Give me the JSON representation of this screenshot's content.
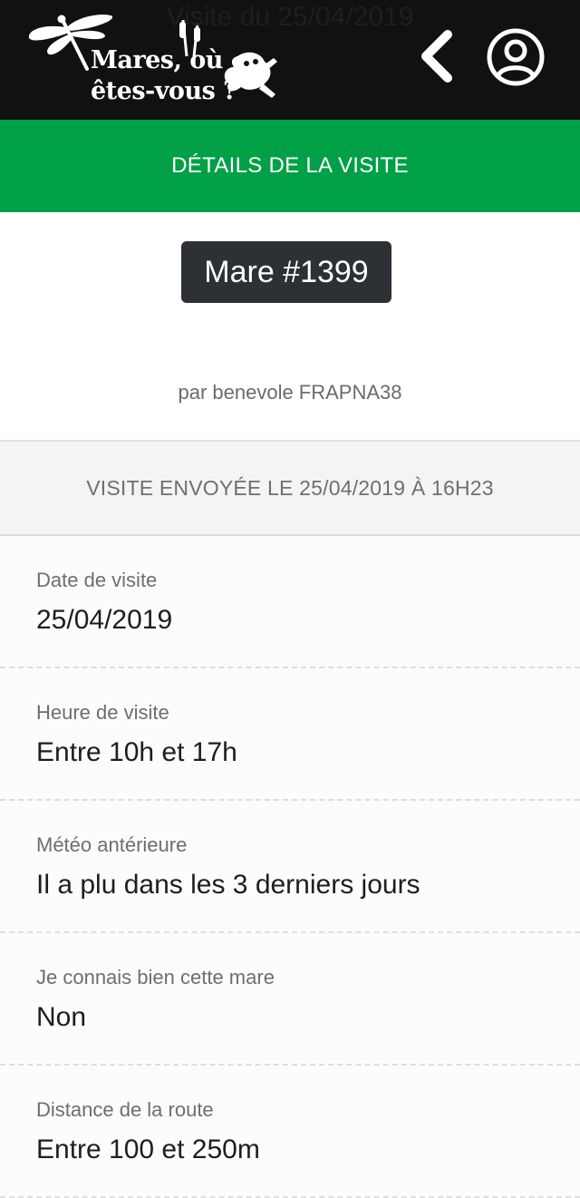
{
  "header": {
    "logo_line1": "Mares, où",
    "logo_line2": "êtes-vous ?",
    "back_icon": "chevron-left-icon",
    "account_icon": "user-circle-icon"
  },
  "subheader": {
    "title": "DÉTAILS DE LA VISITE"
  },
  "summary": {
    "mare_label": "Mare #1399",
    "visit_date": "Visite du 25/04/2019",
    "visitor": "par benevole FRAPNA38"
  },
  "sent_banner": {
    "text": "VISITE ENVOYÉE LE 25/04/2019 À 16H23"
  },
  "fields": [
    {
      "label": "Date de visite",
      "value": "25/04/2019"
    },
    {
      "label": "Heure de visite",
      "value": "Entre 10h et 17h"
    },
    {
      "label": "Météo antérieure",
      "value": "Il a plu dans les 3 derniers jours"
    },
    {
      "label": "Je connais bien cette mare",
      "value": "Non"
    },
    {
      "label": "Distance de la route",
      "value": "Entre 100 et 250m"
    }
  ],
  "colors": {
    "topbar": "#111111",
    "accent_green": "#00a046",
    "badge": "#2d3034"
  }
}
